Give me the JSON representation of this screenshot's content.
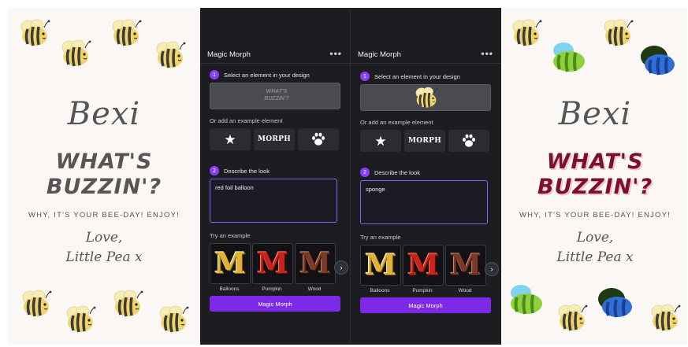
{
  "left_card": {
    "name": "Bexi",
    "headline_line1": "WHAT'S",
    "headline_line2": "BUZZIN'?",
    "tagline": "WHY, IT'S YOUR BEE-DAY! ENJOY!",
    "closing": "Love,",
    "from": "Little Pea x"
  },
  "right_card": {
    "name": "Bexi",
    "headline_line1": "WHAT'S",
    "headline_line2": "BUZZIN'?",
    "tagline": "WHY, IT'S YOUR BEE-DAY! ENJOY!",
    "closing": "Love,",
    "from": "Little Pea x"
  },
  "panel_left": {
    "title": "Magic Morph",
    "more": "•••",
    "step1": {
      "num": "1",
      "label": "Select an element in your design",
      "preview_text": "WHAT'S BUZZIN'?"
    },
    "add_example": "Or add an example element",
    "examples": [
      "★",
      "MORPH",
      "🐾"
    ],
    "step2": {
      "num": "2",
      "label": "Describe the look"
    },
    "prompt_value": "red foil balloon",
    "try_example": "Try an example",
    "styles": [
      {
        "letter": "M",
        "caption": "Balloons"
      },
      {
        "letter": "M",
        "caption": "Pumpkin"
      },
      {
        "letter": "M",
        "caption": "Wood"
      }
    ],
    "next": "›",
    "button": "Magic Morph"
  },
  "panel_right": {
    "title": "Magic Morph",
    "more": "•••",
    "step1": {
      "num": "1",
      "label": "Select an element in your design"
    },
    "add_example": "Or add an example element",
    "examples": [
      "★",
      "MORPH",
      "🐾"
    ],
    "step2": {
      "num": "2",
      "label": "Describe the look"
    },
    "prompt_value": "sponge",
    "try_example": "Try an example",
    "styles": [
      {
        "letter": "M",
        "caption": "Balloons"
      },
      {
        "letter": "M",
        "caption": "Pumpkin"
      },
      {
        "letter": "M",
        "caption": "Wood"
      }
    ],
    "next": "›",
    "button": "Magic Morph"
  },
  "colors": {
    "accent": "#8b3dff",
    "button": "#7d2ae8",
    "panel_bg": "#1c1d21",
    "card_bg": "#fbf7f4"
  }
}
